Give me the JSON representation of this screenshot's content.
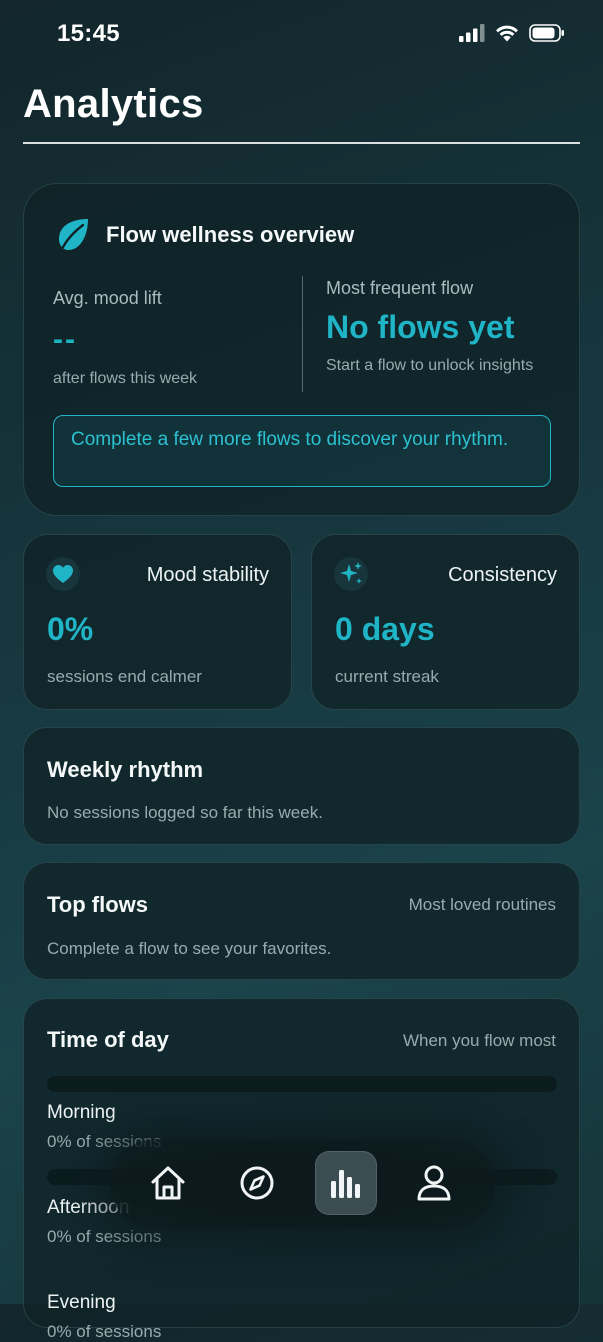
{
  "status_bar": {
    "time": "15:45"
  },
  "page": {
    "title": "Analytics"
  },
  "overview": {
    "title": "Flow wellness overview",
    "avg_mood_label": "Avg. mood lift",
    "avg_mood_value": "--",
    "avg_mood_sub": "after flows this week",
    "frequent_label": "Most frequent flow",
    "frequent_value": "No flows yet",
    "frequent_sub": "Start a flow to unlock insights",
    "hint": "Complete a few more flows to discover your rhythm."
  },
  "stats": [
    {
      "label": "Mood stability",
      "value": "0%",
      "sub": "sessions end calmer",
      "icon": "heart-icon"
    },
    {
      "label": "Consistency",
      "value": "0 days",
      "sub": "current streak",
      "icon": "sparkles-icon"
    }
  ],
  "weekly": {
    "title": "Weekly rhythm",
    "note": "No sessions logged so far this week."
  },
  "top_flows": {
    "title": "Top flows",
    "right": "Most loved routines",
    "note": "Complete a flow to see your favorites."
  },
  "time_of_day": {
    "title": "Time of day",
    "right": "When you flow most",
    "slots": [
      {
        "label": "Morning",
        "sub": "0% of sessions",
        "fraction": 0
      },
      {
        "label": "Afternoon",
        "sub": "0% of sessions",
        "fraction": 0
      },
      {
        "label": "Evening",
        "sub": "0% of sessions",
        "fraction": 0
      }
    ]
  },
  "tab_bar": {
    "items": [
      {
        "icon": "home-icon",
        "active": false
      },
      {
        "icon": "compass-icon",
        "active": false
      },
      {
        "icon": "chart-icon",
        "active": true
      },
      {
        "icon": "profile-icon",
        "active": false
      }
    ]
  },
  "colors": {
    "accent": "#1fb5c6",
    "background": "#173840",
    "card": "#10222a"
  }
}
